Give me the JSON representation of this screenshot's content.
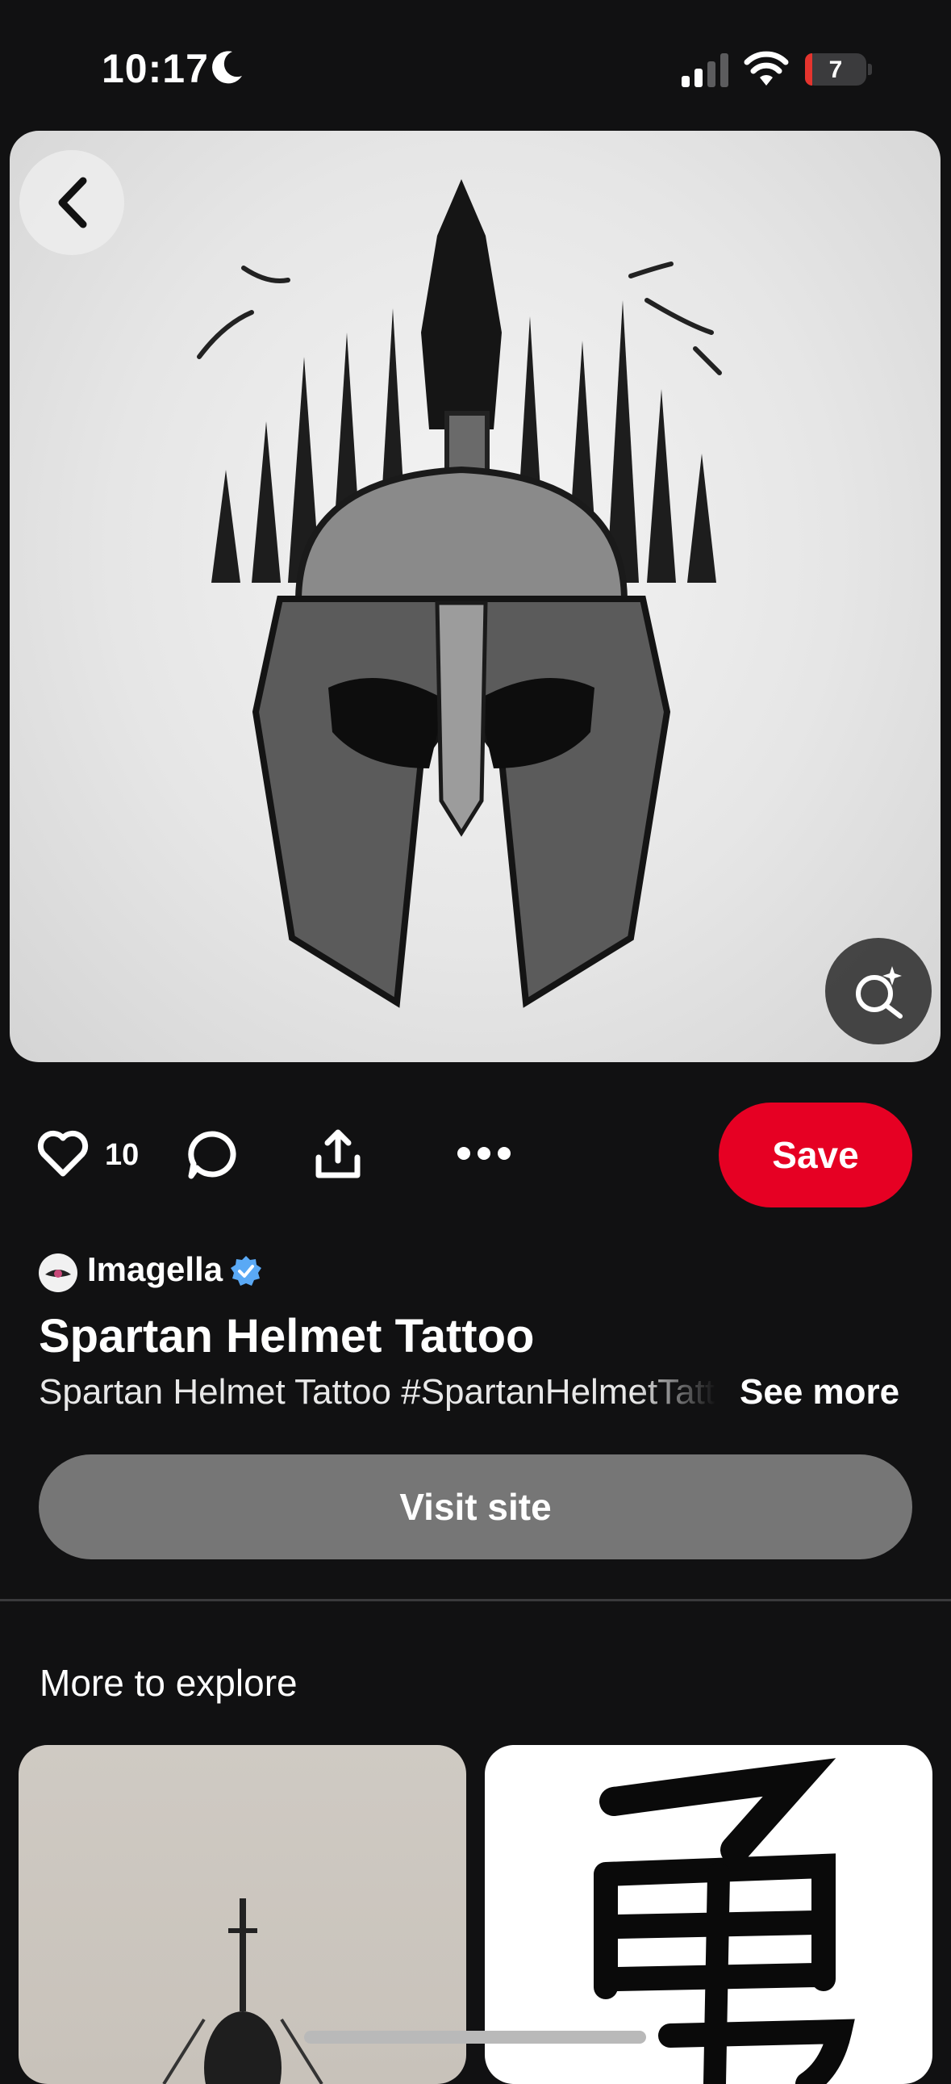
{
  "status_bar": {
    "time": "10:17",
    "battery_level": "7",
    "icons": [
      "moon-icon",
      "cellular-signal-icon",
      "wifi-icon",
      "battery-icon"
    ]
  },
  "pin": {
    "icons": [
      "back-chevron-icon",
      "visual-search-icon"
    ],
    "like_count": "10",
    "save_label": "Save",
    "creator": "Imagella",
    "title": "Spartan Helmet Tattoo",
    "description": "Spartan Helmet Tattoo #SpartanHelmetTattoo",
    "see_more_label": "See more",
    "visit_label": "Visit site"
  },
  "actions": {
    "icons": [
      "heart-icon",
      "comment-icon",
      "share-icon",
      "more-icon"
    ]
  },
  "explore": {
    "heading": "More to explore"
  },
  "colors": {
    "background": "#111112",
    "save_button": "#e60023",
    "visit_button": "#767676",
    "verified_badge": "#5aa9f5"
  }
}
